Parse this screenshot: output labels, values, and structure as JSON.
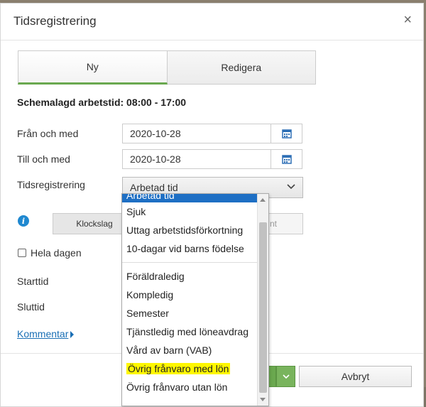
{
  "dialog": {
    "title": "Tidsregistrering",
    "close_glyph": "×"
  },
  "tabs": [
    {
      "label": "Ny",
      "active": true
    },
    {
      "label": "Redigera",
      "active": false
    }
  ],
  "schedule_text": "Schemalagd arbetstid: 08:00 - 17:00",
  "form": {
    "from_label": "Från och med",
    "from_value": "2020-10-28",
    "to_label": "Till och med",
    "to_value": "2020-10-28",
    "type_label": "Tidsregistrering",
    "type_value": "Arbetad tid",
    "segment": {
      "left": "Klockslag",
      "right_partial": "nt"
    },
    "all_day_label": "Hela dagen",
    "start_label": "Starttid",
    "end_label": "Sluttid",
    "comment_link": "Kommentar"
  },
  "footer": {
    "cancel_label": "Avbryt"
  },
  "dropdown": {
    "selected_partial": "Arbetad tid",
    "group1": [
      "Sjuk",
      "Uttag arbetstidsförkortning",
      "10-dagar vid barns födelse"
    ],
    "group2": [
      "Föräldraledig",
      "Kompledig",
      "Semester",
      "Tjänstledig med löneavdrag",
      "Vård av barn (VAB)",
      "Övrig frånvaro med lön",
      "Övrig frånvaro utan lön"
    ],
    "highlighted_item": "Övrig frånvaro med lön"
  },
  "colors": {
    "accent_green": "#6aa84f",
    "selection_blue": "#1e6fc4",
    "link_blue": "#1a6fb5",
    "highlight_yellow": "#fff700"
  }
}
